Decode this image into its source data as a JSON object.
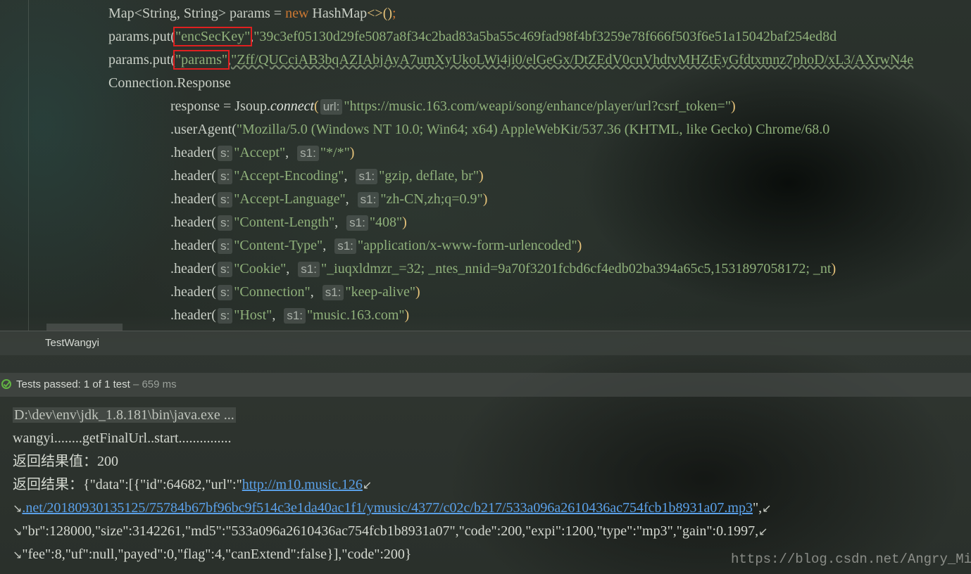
{
  "editor": {
    "line1": {
      "a": "Map",
      "b": "<",
      "c": "String, String",
      "d": "> params = ",
      "kw": "new",
      "e": " HashMap",
      "f": "<>",
      "g": "()",
      "h": ";"
    },
    "line2": {
      "prefix": "params.put(",
      "key": "\"encSecKey\"",
      "comma": ",",
      "value": "\"39c3ef05130d29fe5087a8f34c2bad83a5ba55c469fad98f4bf3259e78f666f503f6e51a15042baf254ed8d"
    },
    "line3": {
      "prefix": "params.put(",
      "key": "\"params\"",
      "comma": ",",
      "value": "\"Zff/QUCciAB3bqAZIAbjAyA7umXyUkoLWi4ji0/elGeGx/DtZEdV0cnVhdtvMHZtEyGfdtxmnz7phoD/xL3/AXrwN4e"
    },
    "line4": {
      "text": "Connection.Response"
    },
    "line5": {
      "prefix": "response = Jsoup.",
      "method": "connect",
      "open": "(",
      "hint": "url:",
      "value": "\"https://music.163.com/weapi/song/enhance/player/url?csrf_token=\"",
      "close": ")"
    },
    "line6": {
      "prefix": ".userAgent(",
      "value": "\"Mozilla/5.0 (Windows NT 10.0; Win64; x64) AppleWebKit/537.36 (KHTML, like Gecko) Chrome/68.0"
    },
    "headers": [
      {
        "s": "\"Accept\"",
        "s1": "\"*/*\""
      },
      {
        "s": "\"Accept-Encoding\"",
        "s1": "\"gzip, deflate, br\""
      },
      {
        "s": "\"Accept-Language\"",
        "s1": "\"zh-CN,zh;q=0.9\""
      },
      {
        "s": "\"Content-Length\"",
        "s1": "\"408\""
      },
      {
        "s": "\"Content-Type\"",
        "s1": "\"application/x-www-form-urlencoded\""
      },
      {
        "s": "\"Cookie\"",
        "s1": "\"_iuqxldmzr_=32; _ntes_nnid=9a70f3201fcbd6cf4edb02ba394a65c5,1531897058172; _nt"
      },
      {
        "s": "\"Connection\"",
        "s1": "\"keep-alive\""
      },
      {
        "s": "\"Host\"",
        "s1": "\"music.163.com\""
      }
    ],
    "header_method": ".header(",
    "hint_s": "s:",
    "hint_s1": "s1:",
    "close": ")"
  },
  "tab": {
    "title": "TestWangyi"
  },
  "run": {
    "passed_label": "Tests passed: ",
    "count": "1",
    "of": " of 1 test",
    "time": " – 659 ms"
  },
  "console": {
    "cmd": "D:\\dev\\env\\jdk_1.8.181\\bin\\java.exe ...",
    "line2": "wangyi........getFinalUrl..start...............",
    "line3": "返回结果值：200",
    "line4_prefix": "返回结果：{\"data\":[{\"id\":64682,\"url\":\"",
    "line4_link": "http://m10.music.126",
    "line5_link": ".net/20180930135125/75784b67bf96bc9f514c3e1da40ac1f1/ymusic/4377/c02c/b217/533a096a2610436ac754fcb1b8931a07.mp3",
    "line5_suffix": "\",",
    "line6": "\"br\":128000,\"size\":3142261,\"md5\":\"533a096a2610436ac754fcb1b8931a07\",\"code\":200,\"expi\":1200,\"type\":\"mp3\",\"gain\":0.1997,",
    "line7": "\"fee\":8,\"uf\":null,\"payed\":0,\"flag\":4,\"canExtend\":false}],\"code\":200}",
    "wrap_start": "↘",
    "wrap_end": "↙"
  },
  "watermark": "https://blog.csdn.net/Angry_Mills"
}
